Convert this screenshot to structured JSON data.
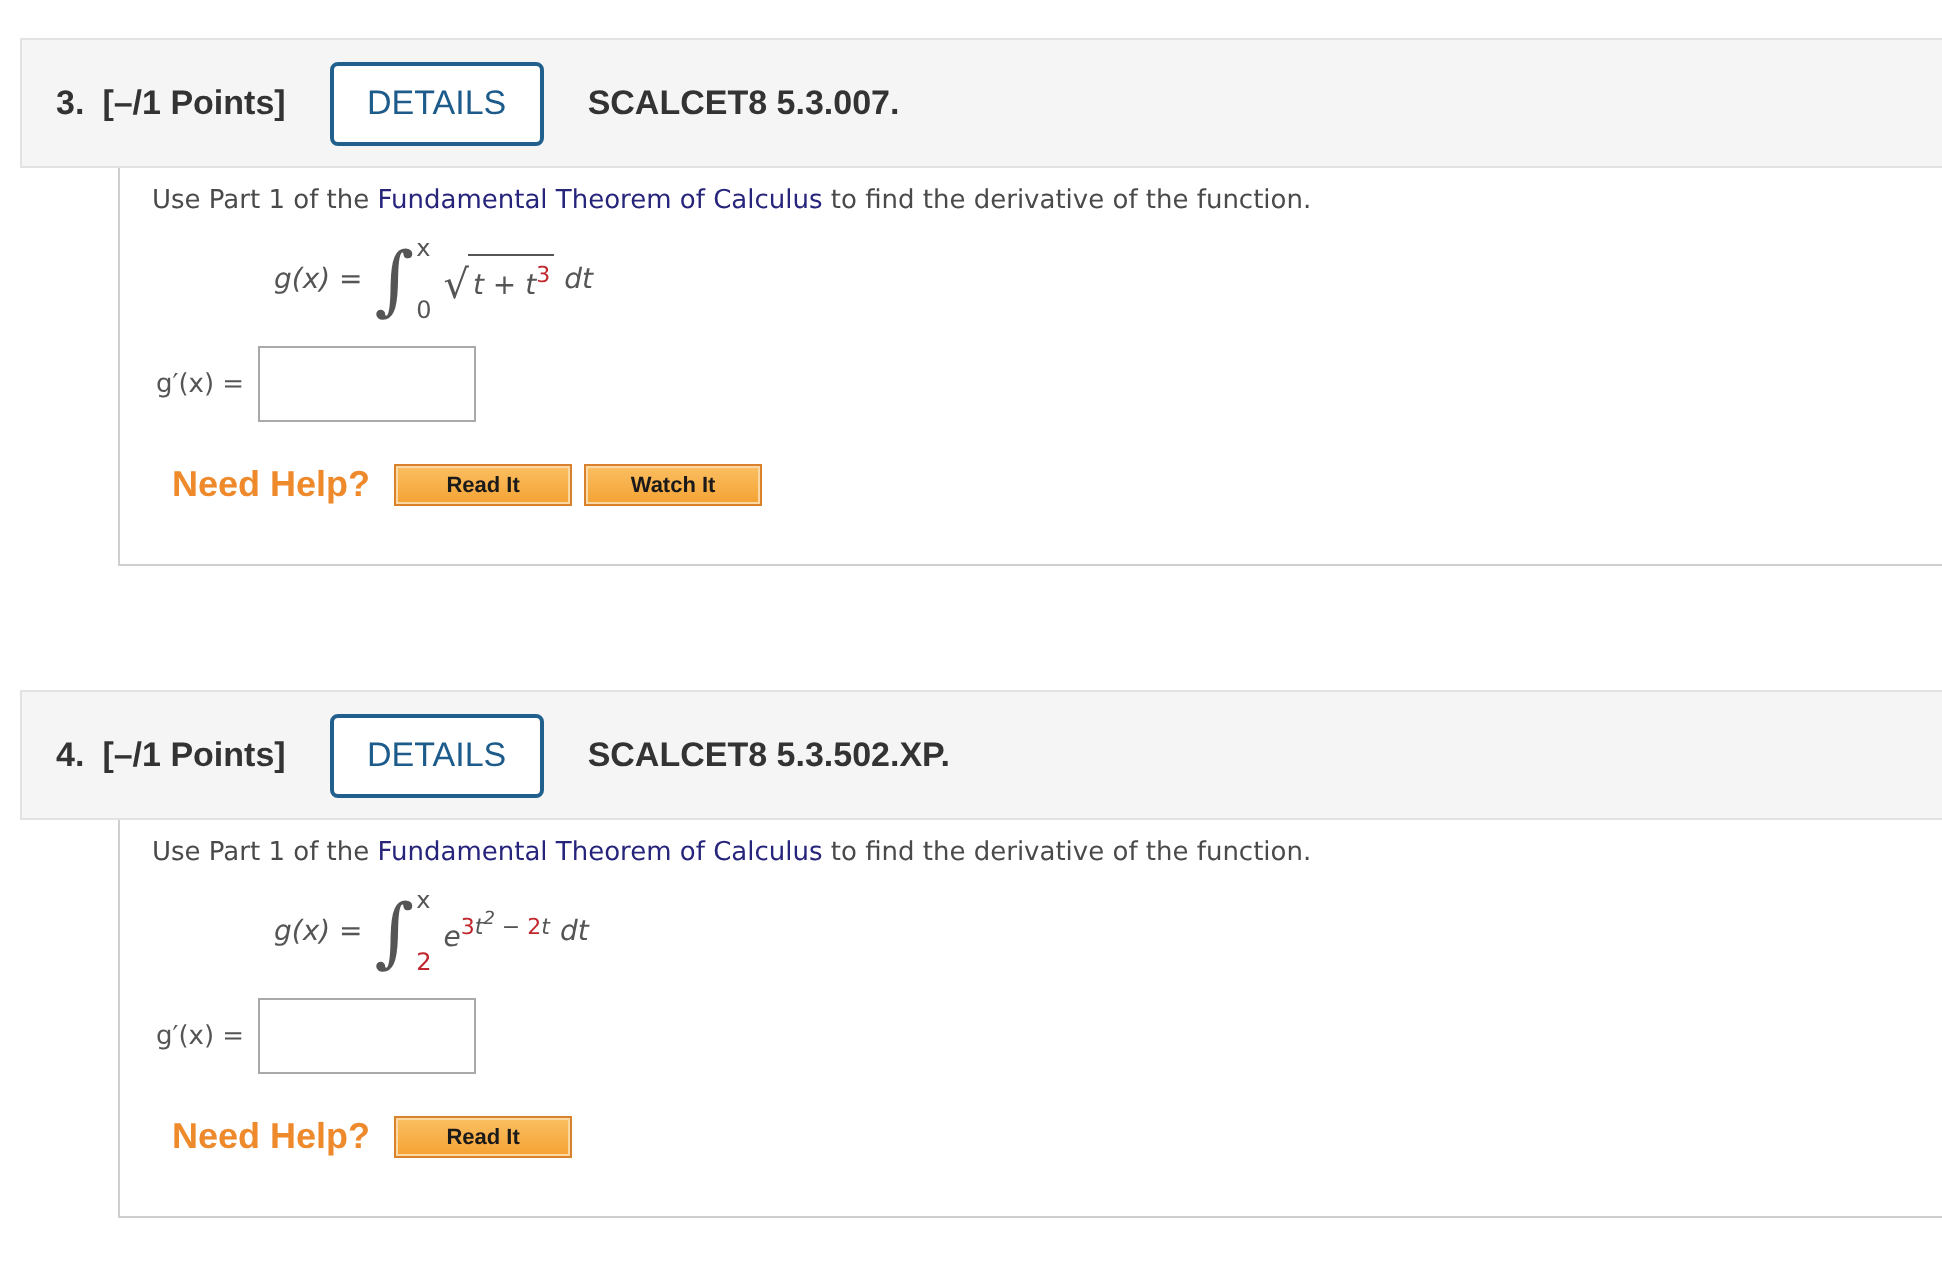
{
  "questions": [
    {
      "number": "3.",
      "points": "[–/1 Points]",
      "details_button": "DETAILS",
      "code": "SCALCET8 5.3.007.",
      "prompt": {
        "before": "Use Part 1 of the ",
        "link": "Fundamental Theorem of Calculus",
        "after": " to find the derivative of the function."
      },
      "formula": {
        "lhs": "g(x) =",
        "integral_sign": "∫",
        "upper_limit": "x",
        "lower_limit": {
          "text": "0",
          "highlight": false
        },
        "radical": "√",
        "integrand": [
          {
            "kind": "base",
            "text": "t + t",
            "highlight": false
          },
          {
            "kind": "sup",
            "text": "3",
            "highlight": true
          }
        ],
        "differential": "dt"
      },
      "answer": {
        "label": "g′(x) ="
      },
      "help": {
        "label": "Need Help?",
        "buttons": [
          "Read It",
          "Watch It"
        ]
      }
    },
    {
      "number": "4.",
      "points": "[–/1 Points]",
      "details_button": "DETAILS",
      "code": "SCALCET8 5.3.502.XP.",
      "prompt": {
        "before": "Use Part 1 of the ",
        "link": "Fundamental Theorem of Calculus",
        "after": " to find the derivative of the function."
      },
      "formula": {
        "lhs": "g(x) =",
        "integral_sign": "∫",
        "upper_limit": "x",
        "lower_limit": {
          "text": "2",
          "highlight": true
        },
        "integrand": [
          {
            "kind": "base",
            "text": "e",
            "highlight": false
          },
          {
            "kind": "sup",
            "text": "3",
            "highlight": true
          },
          {
            "kind": "sup",
            "text": "t",
            "highlight": false
          },
          {
            "kind": "sup2",
            "text": "2",
            "highlight": false
          },
          {
            "kind": "sup",
            "text": " − ",
            "highlight": false
          },
          {
            "kind": "sup",
            "text": "2",
            "highlight": true
          },
          {
            "kind": "sup",
            "text": "t",
            "highlight": false
          }
        ],
        "differential": "dt"
      },
      "answer": {
        "label": "g′(x) ="
      },
      "help": {
        "label": "Need Help?",
        "buttons": [
          "Read It"
        ]
      }
    }
  ]
}
